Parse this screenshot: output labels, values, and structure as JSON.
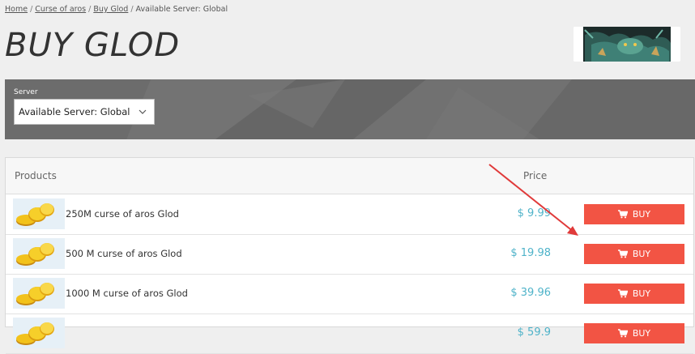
{
  "breadcrumb": {
    "home": "Home",
    "game": "Curse of aros",
    "category": "Buy Glod",
    "current": "Available Server: Global",
    "separator": "/"
  },
  "page": {
    "title": "BUY GLOD"
  },
  "server": {
    "label": "Server",
    "selected": "Available Server: Global"
  },
  "table": {
    "headers": {
      "products": "Products",
      "price": "Price"
    },
    "rows": [
      {
        "name": "250M curse of aros Glod",
        "price": "$ 9.99",
        "buy": "BUY"
      },
      {
        "name": "500 M curse of aros Glod",
        "price": "$ 19.98",
        "buy": "BUY"
      },
      {
        "name": "1000 M curse of aros Glod",
        "price": "$ 39.96",
        "buy": "BUY"
      },
      {
        "name": "",
        "price": "$ 59.9",
        "buy": "BUY"
      }
    ]
  },
  "colors": {
    "accent": "#f25444",
    "price": "#4fb3c9",
    "band": "#6d6d6d",
    "annotation_arrow": "#e03a3a"
  },
  "icons": [
    "cart-icon",
    "chevron-down-icon",
    "gold-coins-icon",
    "dragon-banner-image"
  ]
}
